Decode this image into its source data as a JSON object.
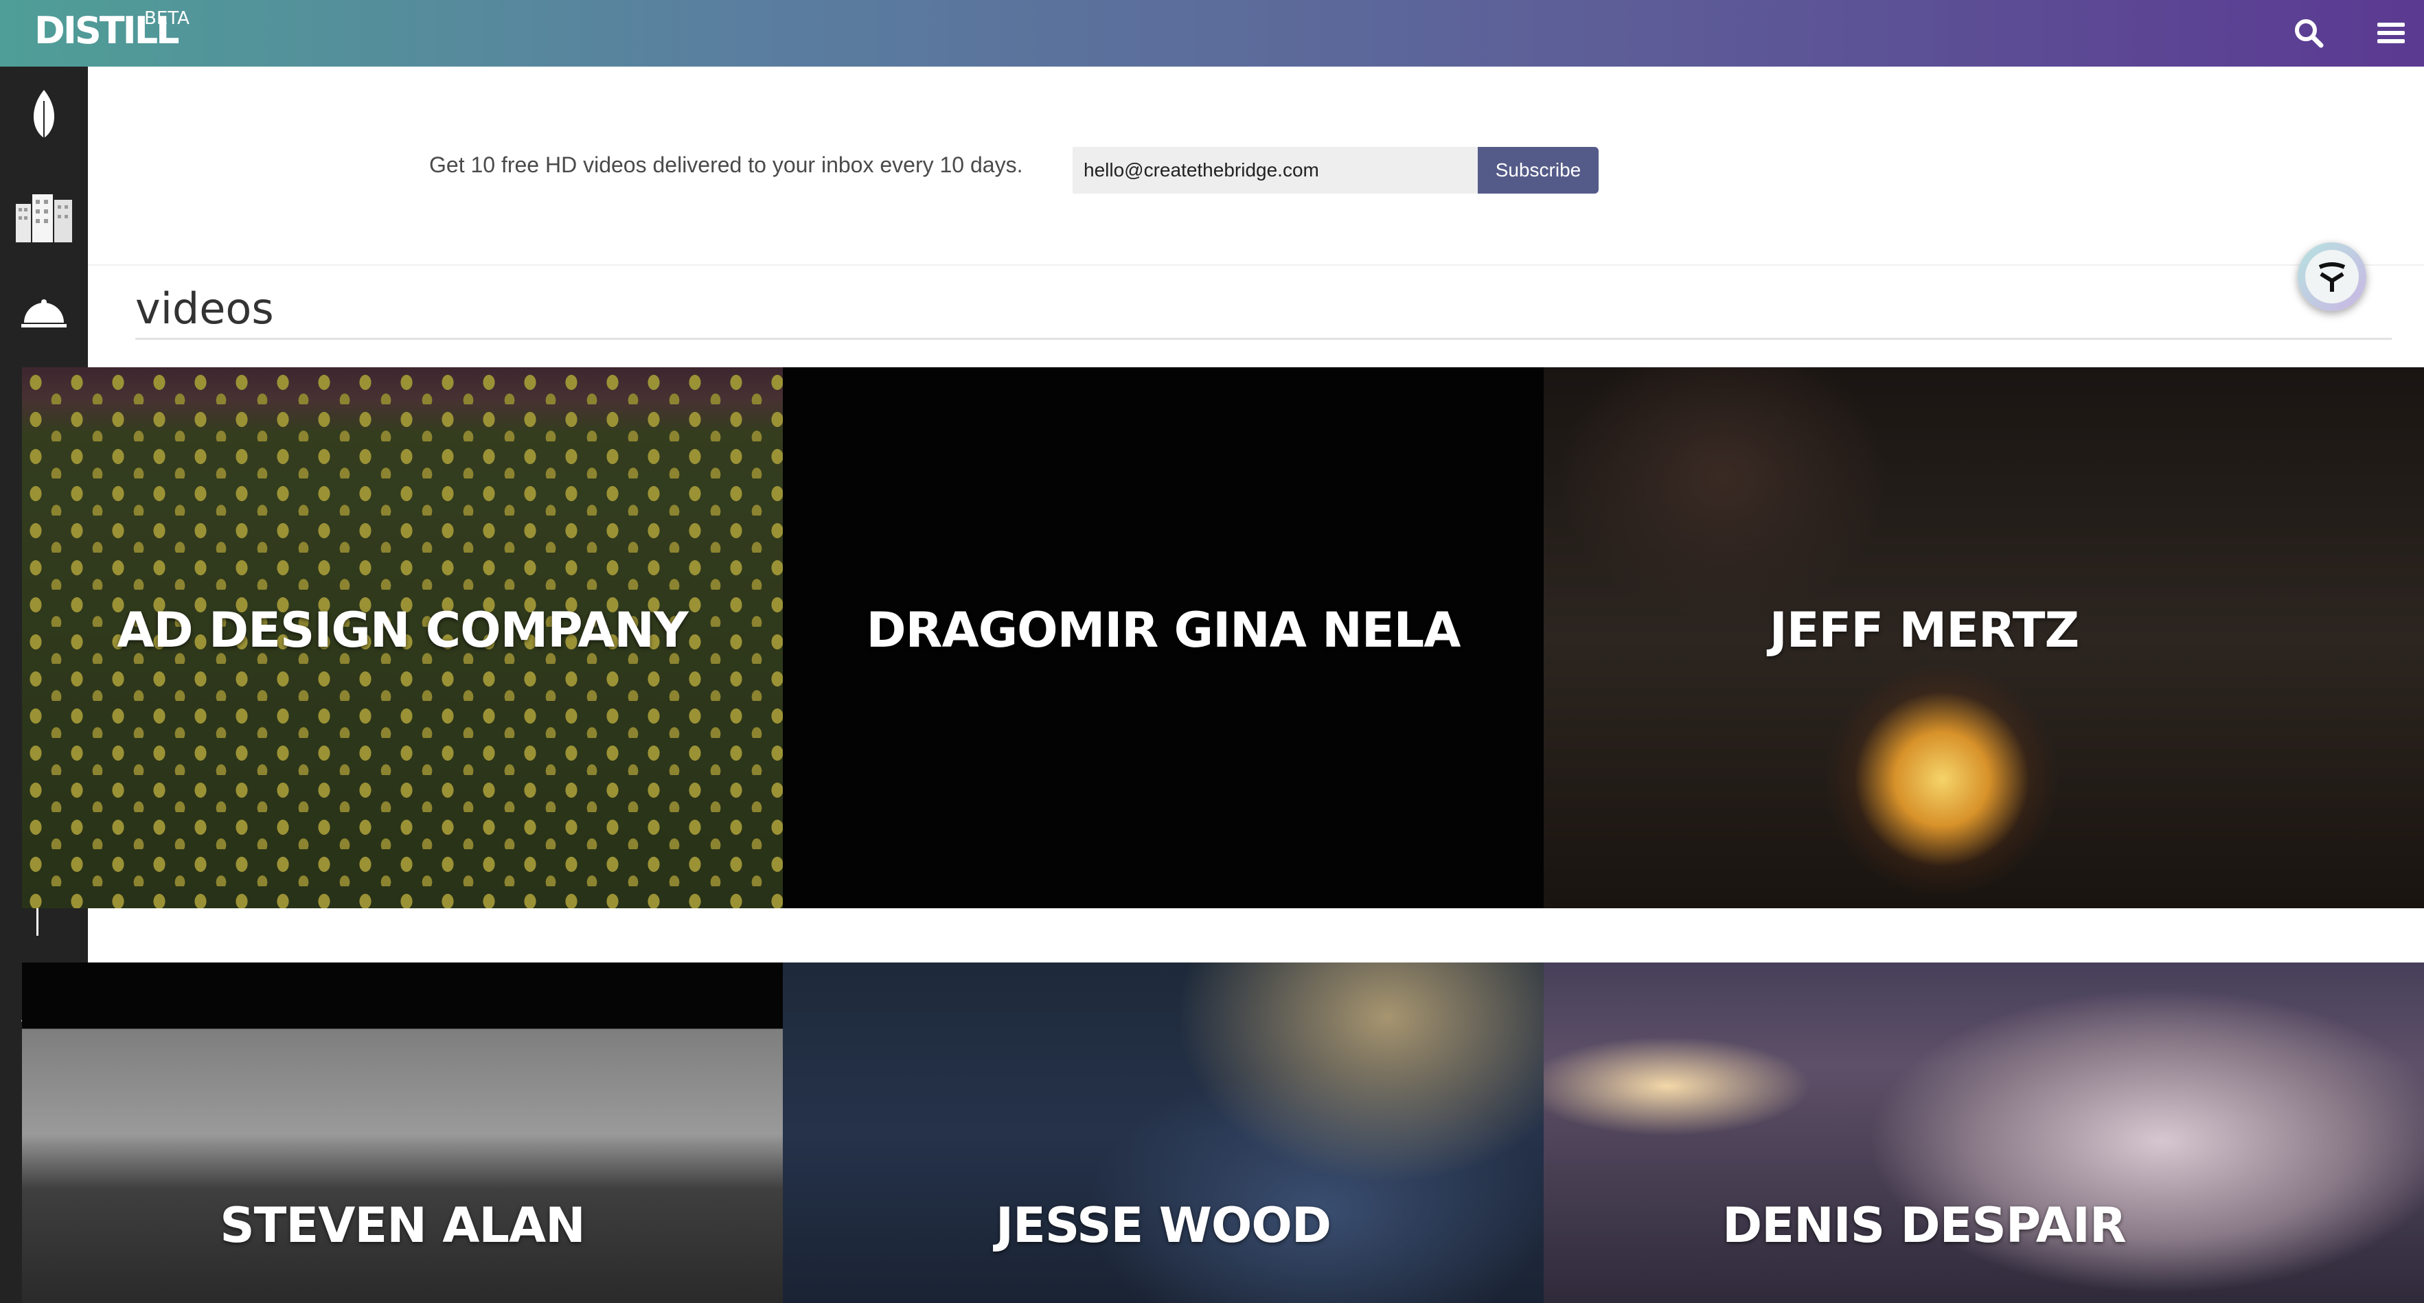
{
  "header": {
    "logo": "DISTILL",
    "badge": "BETA",
    "icons": [
      "search-icon",
      "hamburger-menu-icon"
    ]
  },
  "sidebar": {
    "items": [
      {
        "icon": "leaf-icon"
      },
      {
        "icon": "buildings-icon"
      },
      {
        "icon": "cloche-icon"
      },
      {
        "icon": "thermometer-icon"
      },
      {
        "icon": "bar-icon"
      },
      {
        "icon": "mountain-icon"
      }
    ]
  },
  "subscribe": {
    "text": "Get 10 free HD videos delivered to your inbox every 10 days.",
    "email_value": "hello@createthebridge.com",
    "button_label": "Subscribe"
  },
  "main": {
    "heading": "videos",
    "videos": [
      {
        "title": "AD DESIGN COMPANY"
      },
      {
        "title": "DRAGOMIR GINA NELA"
      },
      {
        "title": "JEFF MERTZ"
      },
      {
        "title": "STEVEN ALAN"
      },
      {
        "title": "JESSE WOOD"
      },
      {
        "title": "DENIS DESPAIR"
      }
    ]
  },
  "fab": {
    "icon": "y-logo-icon"
  },
  "colors": {
    "header_gradient_start": "#4f9e97",
    "header_gradient_end": "#5b3a92",
    "sidebar_bg": "#232323",
    "subscribe_button": "#555b88"
  }
}
